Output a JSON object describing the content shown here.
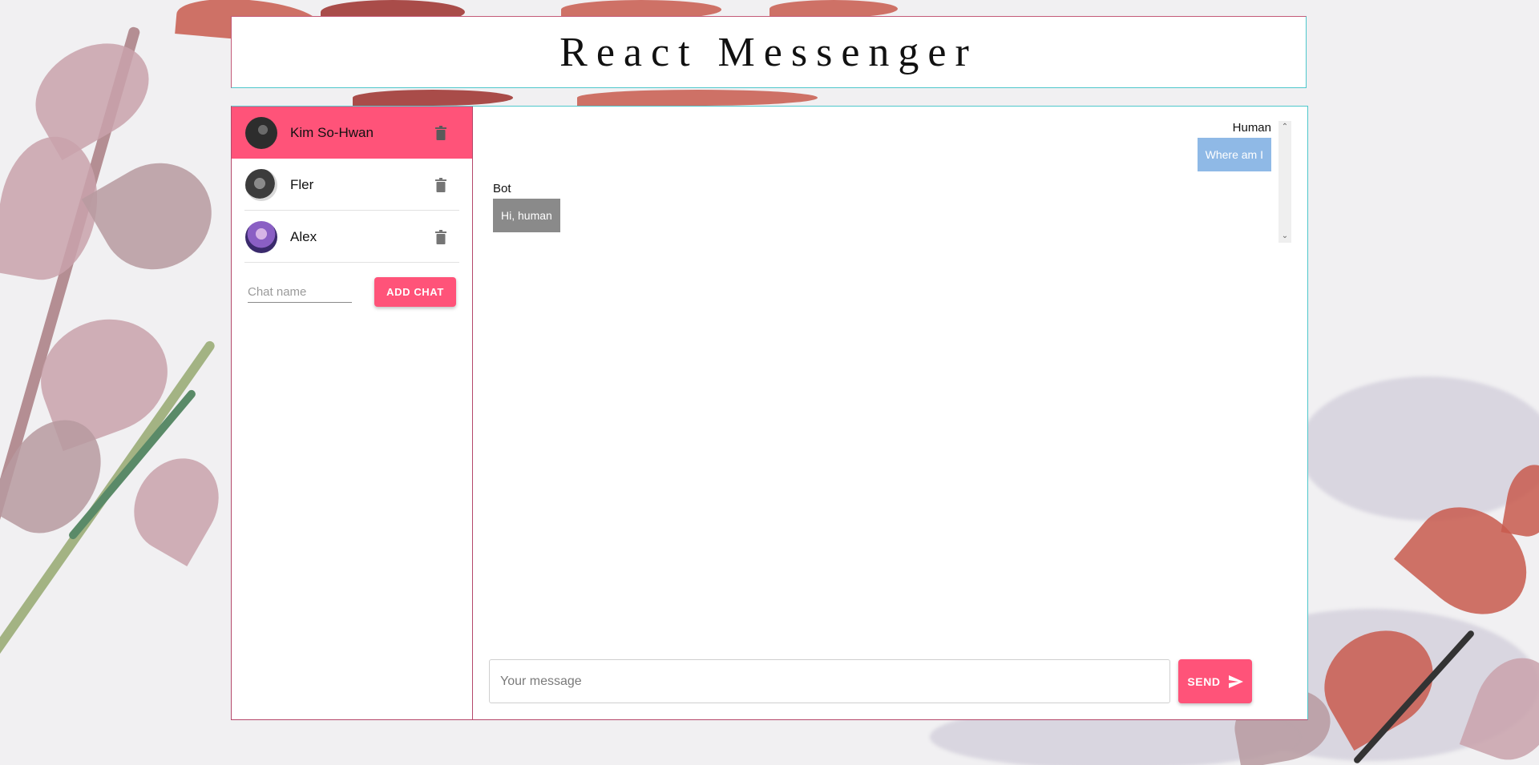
{
  "header": {
    "title": "React Messenger"
  },
  "sidebar": {
    "chats": [
      {
        "name": "Kim So-Hwan",
        "active": true,
        "avatar_icon": "avatar-dark"
      },
      {
        "name": "Fler",
        "active": false,
        "avatar_icon": "avatar-grey"
      },
      {
        "name": "Alex",
        "active": false,
        "avatar_icon": "avatar-purple"
      }
    ],
    "new_chat": {
      "placeholder": "Chat name",
      "button_label": "ADD CHAT"
    }
  },
  "messages": [
    {
      "author": "Human",
      "text": "Where am I",
      "side": "right"
    },
    {
      "author": "Bot",
      "text": "Hi, human",
      "side": "left"
    }
  ],
  "composer": {
    "placeholder": "Your message",
    "send_label": "SEND",
    "send_icon": "send-icon"
  },
  "colors": {
    "accent": "#ff5379",
    "human_bubble": "#8fb9e6",
    "bot_bubble": "#8a8a8a",
    "border": "#4ec7cc"
  }
}
